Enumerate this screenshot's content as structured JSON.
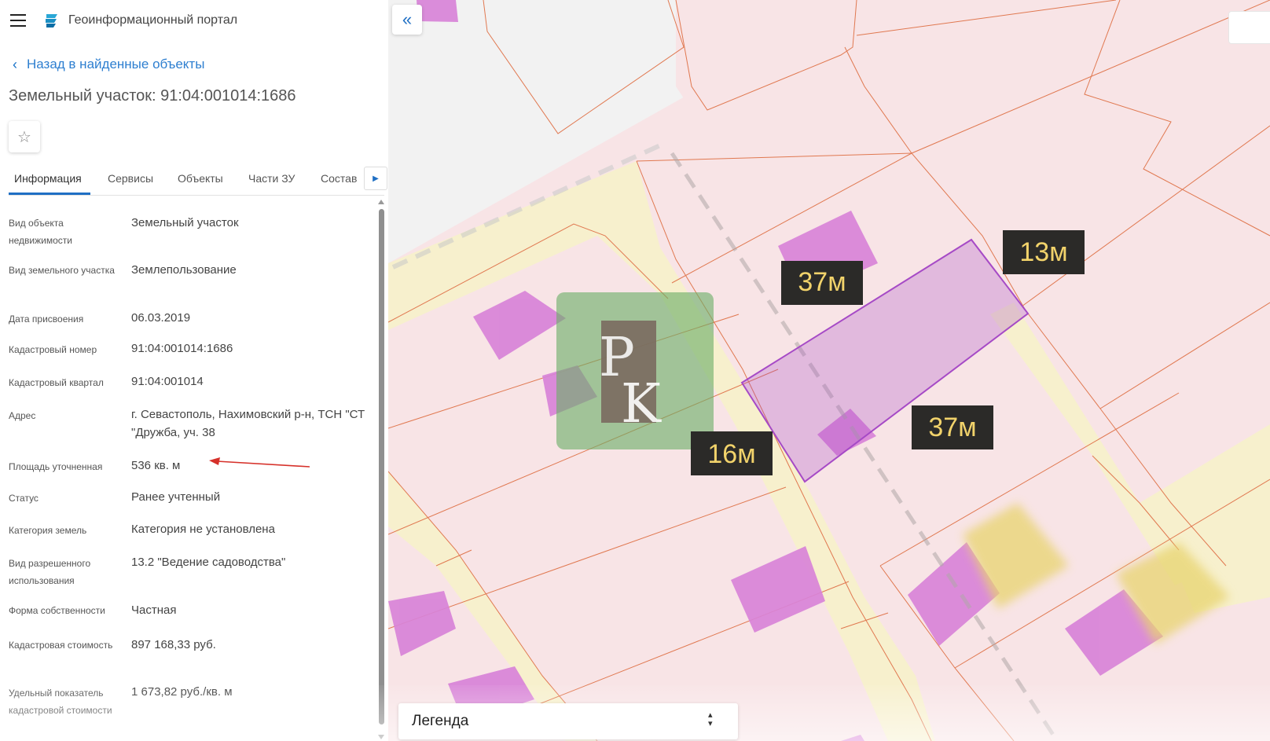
{
  "header": {
    "app_title": "Геоинформационный портал"
  },
  "nav": {
    "back_label": "Назад в найденные объекты"
  },
  "object": {
    "title": "Земельный участок: 91:04:001014:1686"
  },
  "tabs": [
    {
      "label": "Информация",
      "active": true
    },
    {
      "label": "Сервисы"
    },
    {
      "label": "Объекты"
    },
    {
      "label": "Части ЗУ"
    },
    {
      "label": "Состав"
    }
  ],
  "properties": [
    {
      "label": "Вид объекта недвижимости",
      "value": "Земельный участок"
    },
    {
      "label": "Вид земельного участка",
      "value": "Землепользование"
    },
    {
      "label": "Дата присвоения",
      "value": "06.03.2019"
    },
    {
      "label": "Кадастровый номер",
      "value": "91:04:001014:1686"
    },
    {
      "label": "Кадастровый квартал",
      "value": "91:04:001014"
    },
    {
      "label": "Адрес",
      "value": "г. Севастополь, Нахимовский р-н, ТСН \"СТ \"Дружба, уч. 38"
    },
    {
      "label": "Площадь уточненная",
      "value": "536 кв. м"
    },
    {
      "label": "Статус",
      "value": "Ранее учтенный"
    },
    {
      "label": "Категория земель",
      "value": "Категория не установлена"
    },
    {
      "label": "Вид разрешенного использования",
      "value": "13.2 \"Ведение садоводства\""
    },
    {
      "label": "Форма собственности",
      "value": "Частная"
    },
    {
      "label": "Кадастровая стоимость",
      "value": "897 168,33 руб."
    },
    {
      "label": "Удельный показатель кадастровой стоимости",
      "value": "1 673,82 руб./кв. м"
    }
  ],
  "map": {
    "measurements": [
      "37м",
      "13м",
      "16м",
      "37м"
    ],
    "watermark_text": "PK",
    "legend_label": "Легенда",
    "colors": {
      "parcel_fill": "#f8e4e6",
      "road_fill": "#f7f0cd",
      "street_fill": "#f2f2f2",
      "boundary": "#e07850",
      "building": "#d883d8",
      "selected": "#a64ac6",
      "label_bg": "#2b2a28",
      "label_text": "#f2d36b",
      "watermark": "#6cae68"
    }
  },
  "colors": {
    "accent": "#1f6fc4",
    "link": "#2e7fd0"
  }
}
